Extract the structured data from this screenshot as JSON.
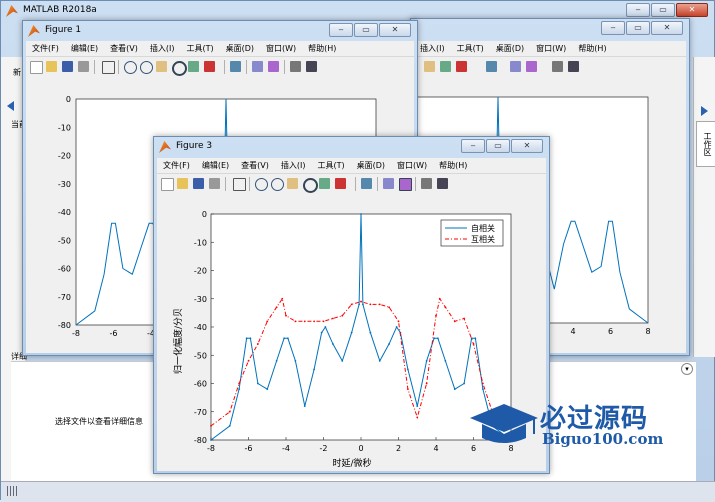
{
  "main_window": {
    "title": "MATLAB R2018a",
    "detail_hint": "选择文件以查看详细信息",
    "side_tab": "工作区",
    "left_labels": [
      "新",
      "当前",
      "详细"
    ]
  },
  "menu": [
    "文件(F)",
    "编辑(E)",
    "查看(V)",
    "插入(I)",
    "工具(T)",
    "桌面(D)",
    "窗口(W)",
    "帮助(H)"
  ],
  "figure1": {
    "title": "Figure 1",
    "yticks": [
      "0",
      "-10",
      "-20",
      "-30",
      "-40",
      "-50",
      "-60",
      "-70",
      "-80"
    ],
    "xticks": [
      "-8",
      "-6",
      "-4"
    ]
  },
  "figure2": {
    "xticks": [
      "4",
      "6",
      "8"
    ]
  },
  "figure3": {
    "title": "Figure 3",
    "xlabel": "时延/微秒",
    "ylabel": "归一化幅度/分贝",
    "legend": [
      "自相关",
      "互相关"
    ]
  },
  "watermark": {
    "line1": "必过源码",
    "line2": "Biguo100.com"
  },
  "chart_data": {
    "type": "line",
    "title": "",
    "xlabel": "时延/微秒",
    "ylabel": "归一化幅度/分贝",
    "xlim": [
      -8,
      8
    ],
    "ylim": [
      -80,
      0
    ],
    "xticks": [
      -8,
      -6,
      -4,
      -2,
      0,
      2,
      4,
      6,
      8
    ],
    "yticks": [
      0,
      -10,
      -20,
      -30,
      -40,
      -50,
      -60,
      -70,
      -80
    ],
    "legend_position": "top-right",
    "grid": false,
    "series": [
      {
        "name": "自相关",
        "color": "#0072bd",
        "style": "solid",
        "x": [
          -8,
          -7,
          -6.5,
          -6.1,
          -5.9,
          -5.5,
          -5,
          -4.5,
          -4.1,
          -3.9,
          -3.5,
          -3,
          -2.5,
          -2.1,
          -1.9,
          -1.5,
          -1,
          -0.5,
          -0.1,
          0,
          0.1,
          0.5,
          1,
          1.5,
          1.9,
          2.1,
          2.5,
          3,
          3.5,
          3.9,
          4.1,
          4.5,
          5,
          5.5,
          5.9,
          6.1,
          6.5,
          7,
          8
        ],
        "y": [
          -80,
          -75,
          -62,
          -44,
          -44,
          -60,
          -62,
          -52,
          -44,
          -44,
          -52,
          -68,
          -55,
          -42,
          -40,
          -46,
          -52,
          -42,
          -32,
          0,
          -32,
          -42,
          -52,
          -46,
          -40,
          -42,
          -55,
          -68,
          -52,
          -44,
          -44,
          -52,
          -62,
          -60,
          -44,
          -44,
          -62,
          -75,
          -80
        ]
      },
      {
        "name": "互相关",
        "color": "#ff0000",
        "style": "dashdot",
        "x": [
          -8,
          -7,
          -6.5,
          -6,
          -5.5,
          -5,
          -4.5,
          -4.2,
          -4,
          -3.5,
          -3,
          -2.5,
          -2,
          -1.5,
          -1,
          -0.5,
          0,
          0.5,
          1,
          1.5,
          2,
          2.5,
          3,
          3.5,
          4,
          4.2,
          4.5,
          5,
          5.5,
          6,
          6.5,
          7,
          8
        ],
        "y": [
          -75,
          -70,
          -60,
          -52,
          -46,
          -38,
          -33,
          -30,
          -36,
          -38,
          -38,
          -38,
          -38,
          -37,
          -36,
          -32,
          -31,
          -32,
          -32,
          -33,
          -38,
          -62,
          -72,
          -60,
          -36,
          -30,
          -33,
          -38,
          -37,
          -46,
          -60,
          -70,
          -75
        ]
      }
    ]
  }
}
